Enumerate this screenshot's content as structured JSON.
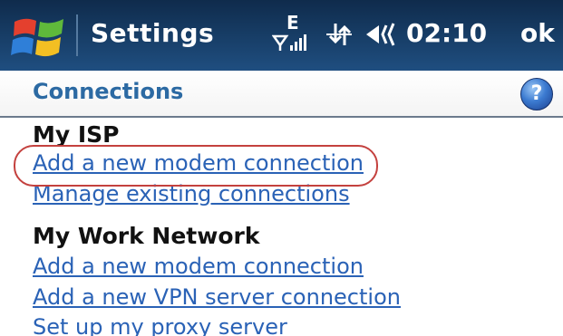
{
  "titlebar": {
    "title": "Settings",
    "clock": "02:10",
    "ok_label": "ok",
    "signal_label": "E",
    "icons": [
      "windows-start-icon",
      "signal-icon",
      "data-connection-icon",
      "volume-icon"
    ]
  },
  "header": {
    "heading": "Connections",
    "help_label": "?"
  },
  "sections": [
    {
      "title": "My ISP",
      "links": [
        "Add a new modem connection",
        "Manage existing connections"
      ]
    },
    {
      "title": "My Work Network",
      "links": [
        "Add a new modem connection",
        "Add a new VPN server connection",
        "Set up my proxy server"
      ]
    }
  ],
  "colors": {
    "titlebar": "#1a4370",
    "heading": "#2c6aa3",
    "link": "#2a62b6",
    "highlight": "#c4413e"
  }
}
